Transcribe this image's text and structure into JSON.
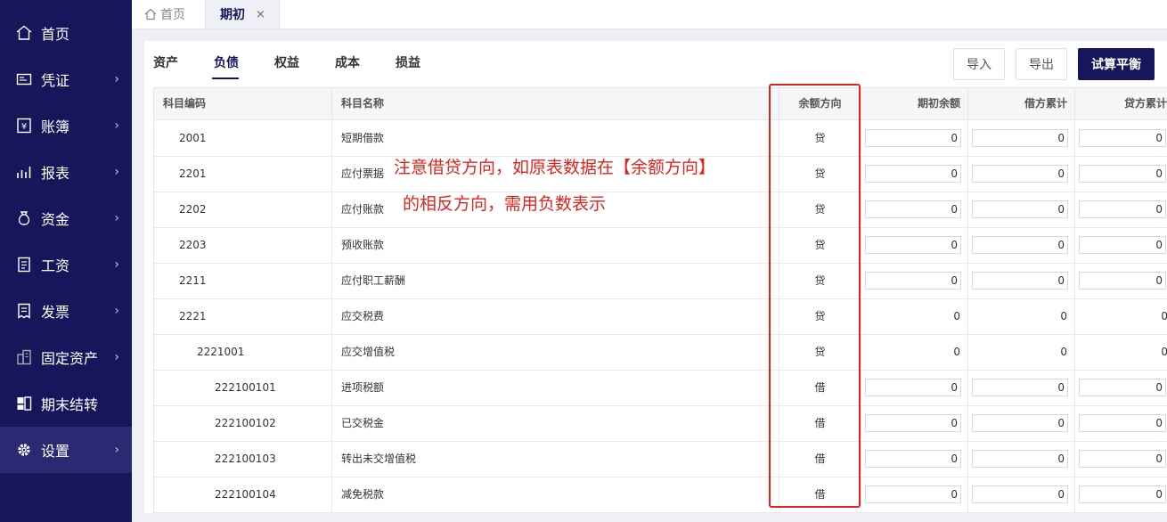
{
  "sidebar": {
    "items": [
      {
        "label": "首页",
        "icon": "home-icon",
        "arrow": false,
        "active": false
      },
      {
        "label": "凭证",
        "icon": "voucher-icon",
        "arrow": true,
        "active": false
      },
      {
        "label": "账簿",
        "icon": "ledger-icon",
        "arrow": true,
        "active": false
      },
      {
        "label": "报表",
        "icon": "chart-icon",
        "arrow": true,
        "active": false
      },
      {
        "label": "资金",
        "icon": "money-bag-icon",
        "arrow": true,
        "active": false
      },
      {
        "label": "工资",
        "icon": "document-icon",
        "arrow": true,
        "active": false
      },
      {
        "label": "发票",
        "icon": "invoice-icon",
        "arrow": true,
        "active": false
      },
      {
        "label": "固定资产",
        "icon": "building-icon",
        "arrow": true,
        "active": false
      },
      {
        "label": "期末结转",
        "icon": "transfer-icon",
        "arrow": false,
        "active": false
      },
      {
        "label": "设置",
        "icon": "gear-icon",
        "arrow": true,
        "active": true
      }
    ]
  },
  "tabs": {
    "home_label": "首页",
    "active_label": "期初",
    "close_glyph": "×"
  },
  "categories": [
    "资产",
    "负债",
    "权益",
    "成本",
    "损益"
  ],
  "active_category": "负债",
  "buttons": {
    "import": "导入",
    "export": "导出",
    "trial_balance": "试算平衡"
  },
  "table": {
    "headers": {
      "code": "科目编码",
      "name": "科目名称",
      "direction": "余额方向",
      "opening": "期初余额",
      "debit": "借方累计",
      "credit": "贷方累计"
    },
    "rows": [
      {
        "code": "2001",
        "level": 0,
        "name": "短期借款",
        "direction": "贷",
        "editable": true,
        "opening": "0",
        "debit": "0",
        "credit": "0"
      },
      {
        "code": "2201",
        "level": 0,
        "name": "应付票据",
        "direction": "贷",
        "editable": true,
        "opening": "0",
        "debit": "0",
        "credit": "0"
      },
      {
        "code": "2202",
        "level": 0,
        "name": "应付账款",
        "direction": "贷",
        "editable": true,
        "opening": "0",
        "debit": "0",
        "credit": "0"
      },
      {
        "code": "2203",
        "level": 0,
        "name": "预收账款",
        "direction": "贷",
        "editable": true,
        "opening": "0",
        "debit": "0",
        "credit": "0"
      },
      {
        "code": "2211",
        "level": 0,
        "name": "应付职工薪酬",
        "direction": "贷",
        "editable": true,
        "opening": "0",
        "debit": "0",
        "credit": "0"
      },
      {
        "code": "2221",
        "level": 0,
        "name": "应交税费",
        "direction": "贷",
        "editable": false,
        "opening": "0",
        "debit": "0",
        "credit": "0"
      },
      {
        "code": "2221001",
        "level": 1,
        "name": "应交增值税",
        "direction": "贷",
        "editable": false,
        "opening": "0",
        "debit": "0",
        "credit": "0"
      },
      {
        "code": "222100101",
        "level": 2,
        "name": "进项税额",
        "direction": "借",
        "editable": true,
        "opening": "0",
        "debit": "0",
        "credit": "0"
      },
      {
        "code": "222100102",
        "level": 2,
        "name": "已交税金",
        "direction": "借",
        "editable": true,
        "opening": "0",
        "debit": "0",
        "credit": "0"
      },
      {
        "code": "222100103",
        "level": 2,
        "name": "转出未交增值税",
        "direction": "借",
        "editable": true,
        "opening": "0",
        "debit": "0",
        "credit": "0"
      },
      {
        "code": "222100104",
        "level": 2,
        "name": "减免税款",
        "direction": "借",
        "editable": true,
        "opening": "0",
        "debit": "0",
        "credit": "0"
      }
    ]
  },
  "annotation": {
    "line1": "注意借贷方向，如原表数据在【余额方向】",
    "line2": "的相反方向，需用负数表示",
    "color": "#e0231c"
  },
  "colors": {
    "sidebar_bg": "#16165a",
    "primary": "#16165a",
    "annotation": "#e0231c"
  }
}
